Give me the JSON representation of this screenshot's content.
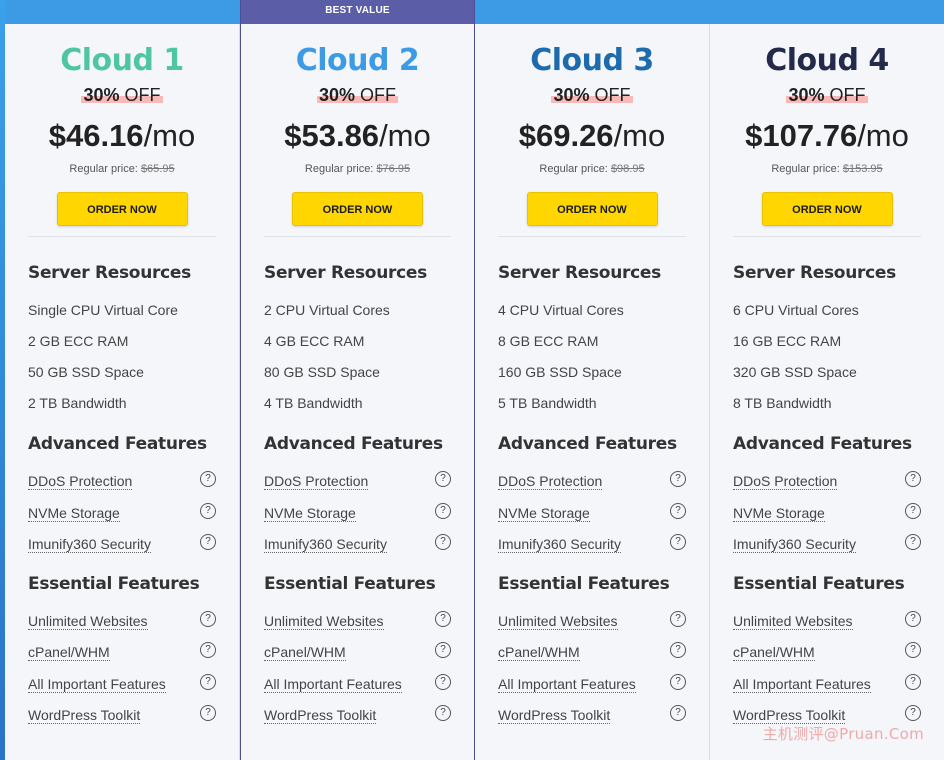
{
  "badge": "BEST VALUE",
  "section_labels": {
    "server": "Server Resources",
    "advanced": "Advanced Features",
    "essential": "Essential Features"
  },
  "help_glyph": "?",
  "watermark": "主机测评@Pruan.Com",
  "plans": [
    {
      "name": "Cloud 1",
      "name_color": "#4fc6a1",
      "discount_pct": "30%",
      "discount_off": "OFF",
      "price": "$46.16",
      "per": "/mo",
      "regular_label": "Regular price:",
      "regular_price": "$65.95",
      "order_label": "ORDER NOW",
      "resources": [
        "Single CPU Virtual Core",
        "2 GB ECC RAM",
        "50 GB SSD Space",
        "2 TB Bandwidth"
      ],
      "advanced": [
        "DDoS Protection",
        "NVMe Storage",
        "Imunify360 Security"
      ],
      "essential": [
        "Unlimited Websites",
        "cPanel/WHM",
        "All Important Features",
        "WordPress Toolkit"
      ]
    },
    {
      "name": "Cloud 2",
      "name_color": "#3d9be6",
      "discount_pct": "30%",
      "discount_off": "OFF",
      "price": "$53.86",
      "per": "/mo",
      "regular_label": "Regular price:",
      "regular_price": "$76.95",
      "order_label": "ORDER NOW",
      "resources": [
        "2 CPU Virtual Cores",
        "4 GB ECC RAM",
        "80 GB SSD Space",
        "4 TB Bandwidth"
      ],
      "advanced": [
        "DDoS Protection",
        "NVMe Storage",
        "Imunify360 Security"
      ],
      "essential": [
        "Unlimited Websites",
        "cPanel/WHM",
        "All Important Features",
        "WordPress Toolkit"
      ]
    },
    {
      "name": "Cloud 3",
      "name_color": "#1d6aad",
      "discount_pct": "30%",
      "discount_off": "OFF",
      "price": "$69.26",
      "per": "/mo",
      "regular_label": "Regular price:",
      "regular_price": "$98.95",
      "order_label": "ORDER NOW",
      "resources": [
        "4 CPU Virtual Cores",
        "8 GB ECC RAM",
        "160 GB SSD Space",
        "5 TB Bandwidth"
      ],
      "advanced": [
        "DDoS Protection",
        "NVMe Storage",
        "Imunify360 Security"
      ],
      "essential": [
        "Unlimited Websites",
        "cPanel/WHM",
        "All Important Features",
        "WordPress Toolkit"
      ]
    },
    {
      "name": "Cloud 4",
      "name_color": "#232a4a",
      "discount_pct": "30%",
      "discount_off": "OFF",
      "price": "$107.76",
      "per": "/mo",
      "regular_label": "Regular price:",
      "regular_price": "$153.95",
      "order_label": "ORDER NOW",
      "resources": [
        "6 CPU Virtual Cores",
        "16 GB ECC RAM",
        "320 GB SSD Space",
        "8 TB Bandwidth"
      ],
      "advanced": [
        "DDoS Protection",
        "NVMe Storage",
        "Imunify360 Security"
      ],
      "essential": [
        "Unlimited Websites",
        "cPanel/WHM",
        "All Important Features",
        "WordPress Toolkit"
      ]
    }
  ]
}
